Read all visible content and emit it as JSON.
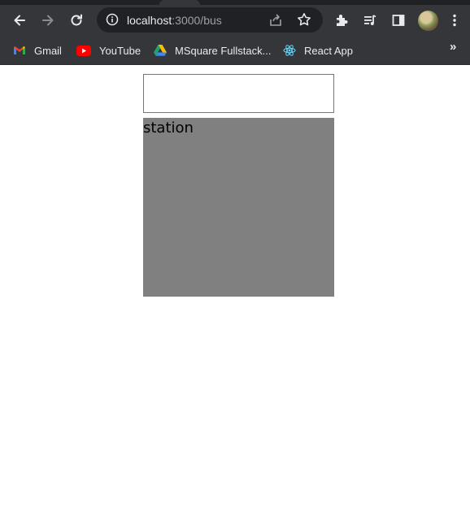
{
  "browser": {
    "url_host": "localhost",
    "url_path": ":3000/bus",
    "toolbar_icons": [
      "back-icon",
      "forward-icon",
      "reload-icon",
      "info-icon",
      "share-icon",
      "star-icon",
      "extensions-icon",
      "media-icon",
      "side-panel-icon",
      "avatar",
      "menu-icon"
    ],
    "bookmarks": [
      {
        "label": "Gmail",
        "icon": "gmail-icon"
      },
      {
        "label": "YouTube",
        "icon": "youtube-icon"
      },
      {
        "label": "MSquare Fullstack...",
        "icon": "drive-icon"
      },
      {
        "label": "React App",
        "icon": "react-icon"
      }
    ],
    "overflow": "»"
  },
  "page": {
    "search_value": "",
    "station_label": "station",
    "panel_color": "#808080"
  }
}
